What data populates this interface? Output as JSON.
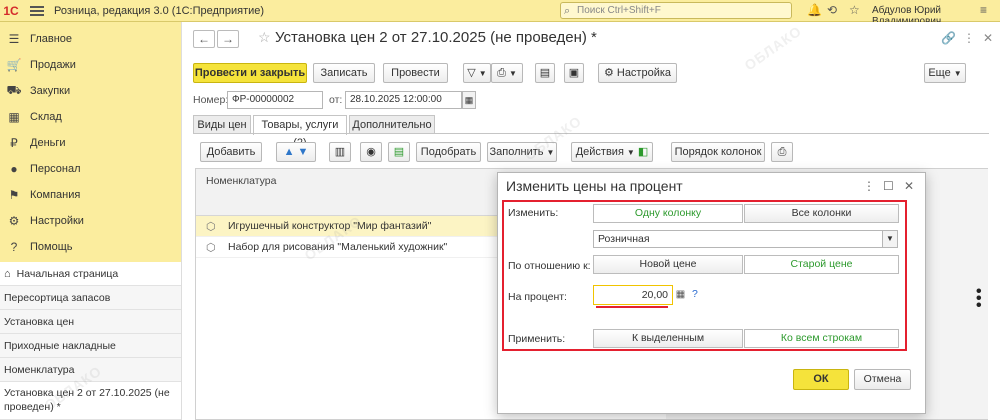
{
  "app": {
    "logo": "1С",
    "title": "Розница, редакция 3.0  (1С:Предприятие)",
    "search_placeholder": "Поиск Ctrl+Shift+F",
    "user": "Абдулов Юрий Владимирович"
  },
  "sidebar": {
    "sections": [
      {
        "label": "Главное",
        "icon": "menu-icon",
        "glyph": "☰"
      },
      {
        "label": "Продажи",
        "icon": "cart-icon",
        "glyph": "🛒"
      },
      {
        "label": "Закупки",
        "icon": "truck-icon",
        "glyph": "⛟"
      },
      {
        "label": "Склад",
        "icon": "warehouse-icon",
        "glyph": "▦"
      },
      {
        "label": "Деньги",
        "icon": "money-icon",
        "glyph": "₽"
      },
      {
        "label": "Персонал",
        "icon": "person-icon",
        "glyph": "●"
      },
      {
        "label": "Компания",
        "icon": "flag-icon",
        "glyph": "⚑"
      },
      {
        "label": "Настройки",
        "icon": "gear-icon",
        "glyph": "⚙"
      },
      {
        "label": "Помощь",
        "icon": "help-icon",
        "glyph": "?"
      }
    ],
    "home": "Начальная страница",
    "open_items": [
      "Пересортица запасов",
      "Установка цен",
      "Приходные накладные",
      "Номенклатура"
    ],
    "active_item": "Установка цен 2 от 27.10.2025 (не проведен) *"
  },
  "document": {
    "title": "Установка цен 2 от 27.10.2025 (не проведен) *",
    "toolbar": {
      "post_close": "Провести и закрыть",
      "save": "Записать",
      "post": "Провести",
      "settings": "Настройка",
      "more": "Еще"
    },
    "number_label": "Номер:",
    "number": "ФР-00000002",
    "date_label": "от:",
    "date": "28.10.2025 12:00:00",
    "tabs": [
      "Виды цен",
      "Товары, услуги (2)",
      "Дополнительно"
    ],
    "table_toolbar": {
      "add": "Добавить",
      "pick": "Подобрать",
      "fill": "Заполнить",
      "actions": "Действия",
      "column_order": "Порядок колонок"
    },
    "table": {
      "column": "Номенклатура",
      "rows": [
        "Игрушечный конструктор \"Мир фантазий\"",
        "Набор для рисования \"Маленький художник\""
      ]
    }
  },
  "dialog": {
    "title": "Изменить цены на процент",
    "change_label": "Изменить:",
    "change_options": [
      "Одну колонку",
      "Все колонки"
    ],
    "price_type": "Розничная",
    "relative_label": "По отношению к:",
    "relative_options": [
      "Новой цене",
      "Старой цене"
    ],
    "percent_label": "На процент:",
    "percent_value": "20,00",
    "help": "?",
    "apply_label": "Применить:",
    "apply_options": [
      "К выделенным",
      "Ко всем строкам"
    ],
    "ok": "ОК",
    "cancel": "Отмена"
  },
  "watermark": "ОБЛАКО",
  "colors": {
    "accent": "#f5e33b",
    "highlight": "#e4202f",
    "sidebar_bg": "#fbed9e",
    "active_option": "#2d9a2d"
  }
}
